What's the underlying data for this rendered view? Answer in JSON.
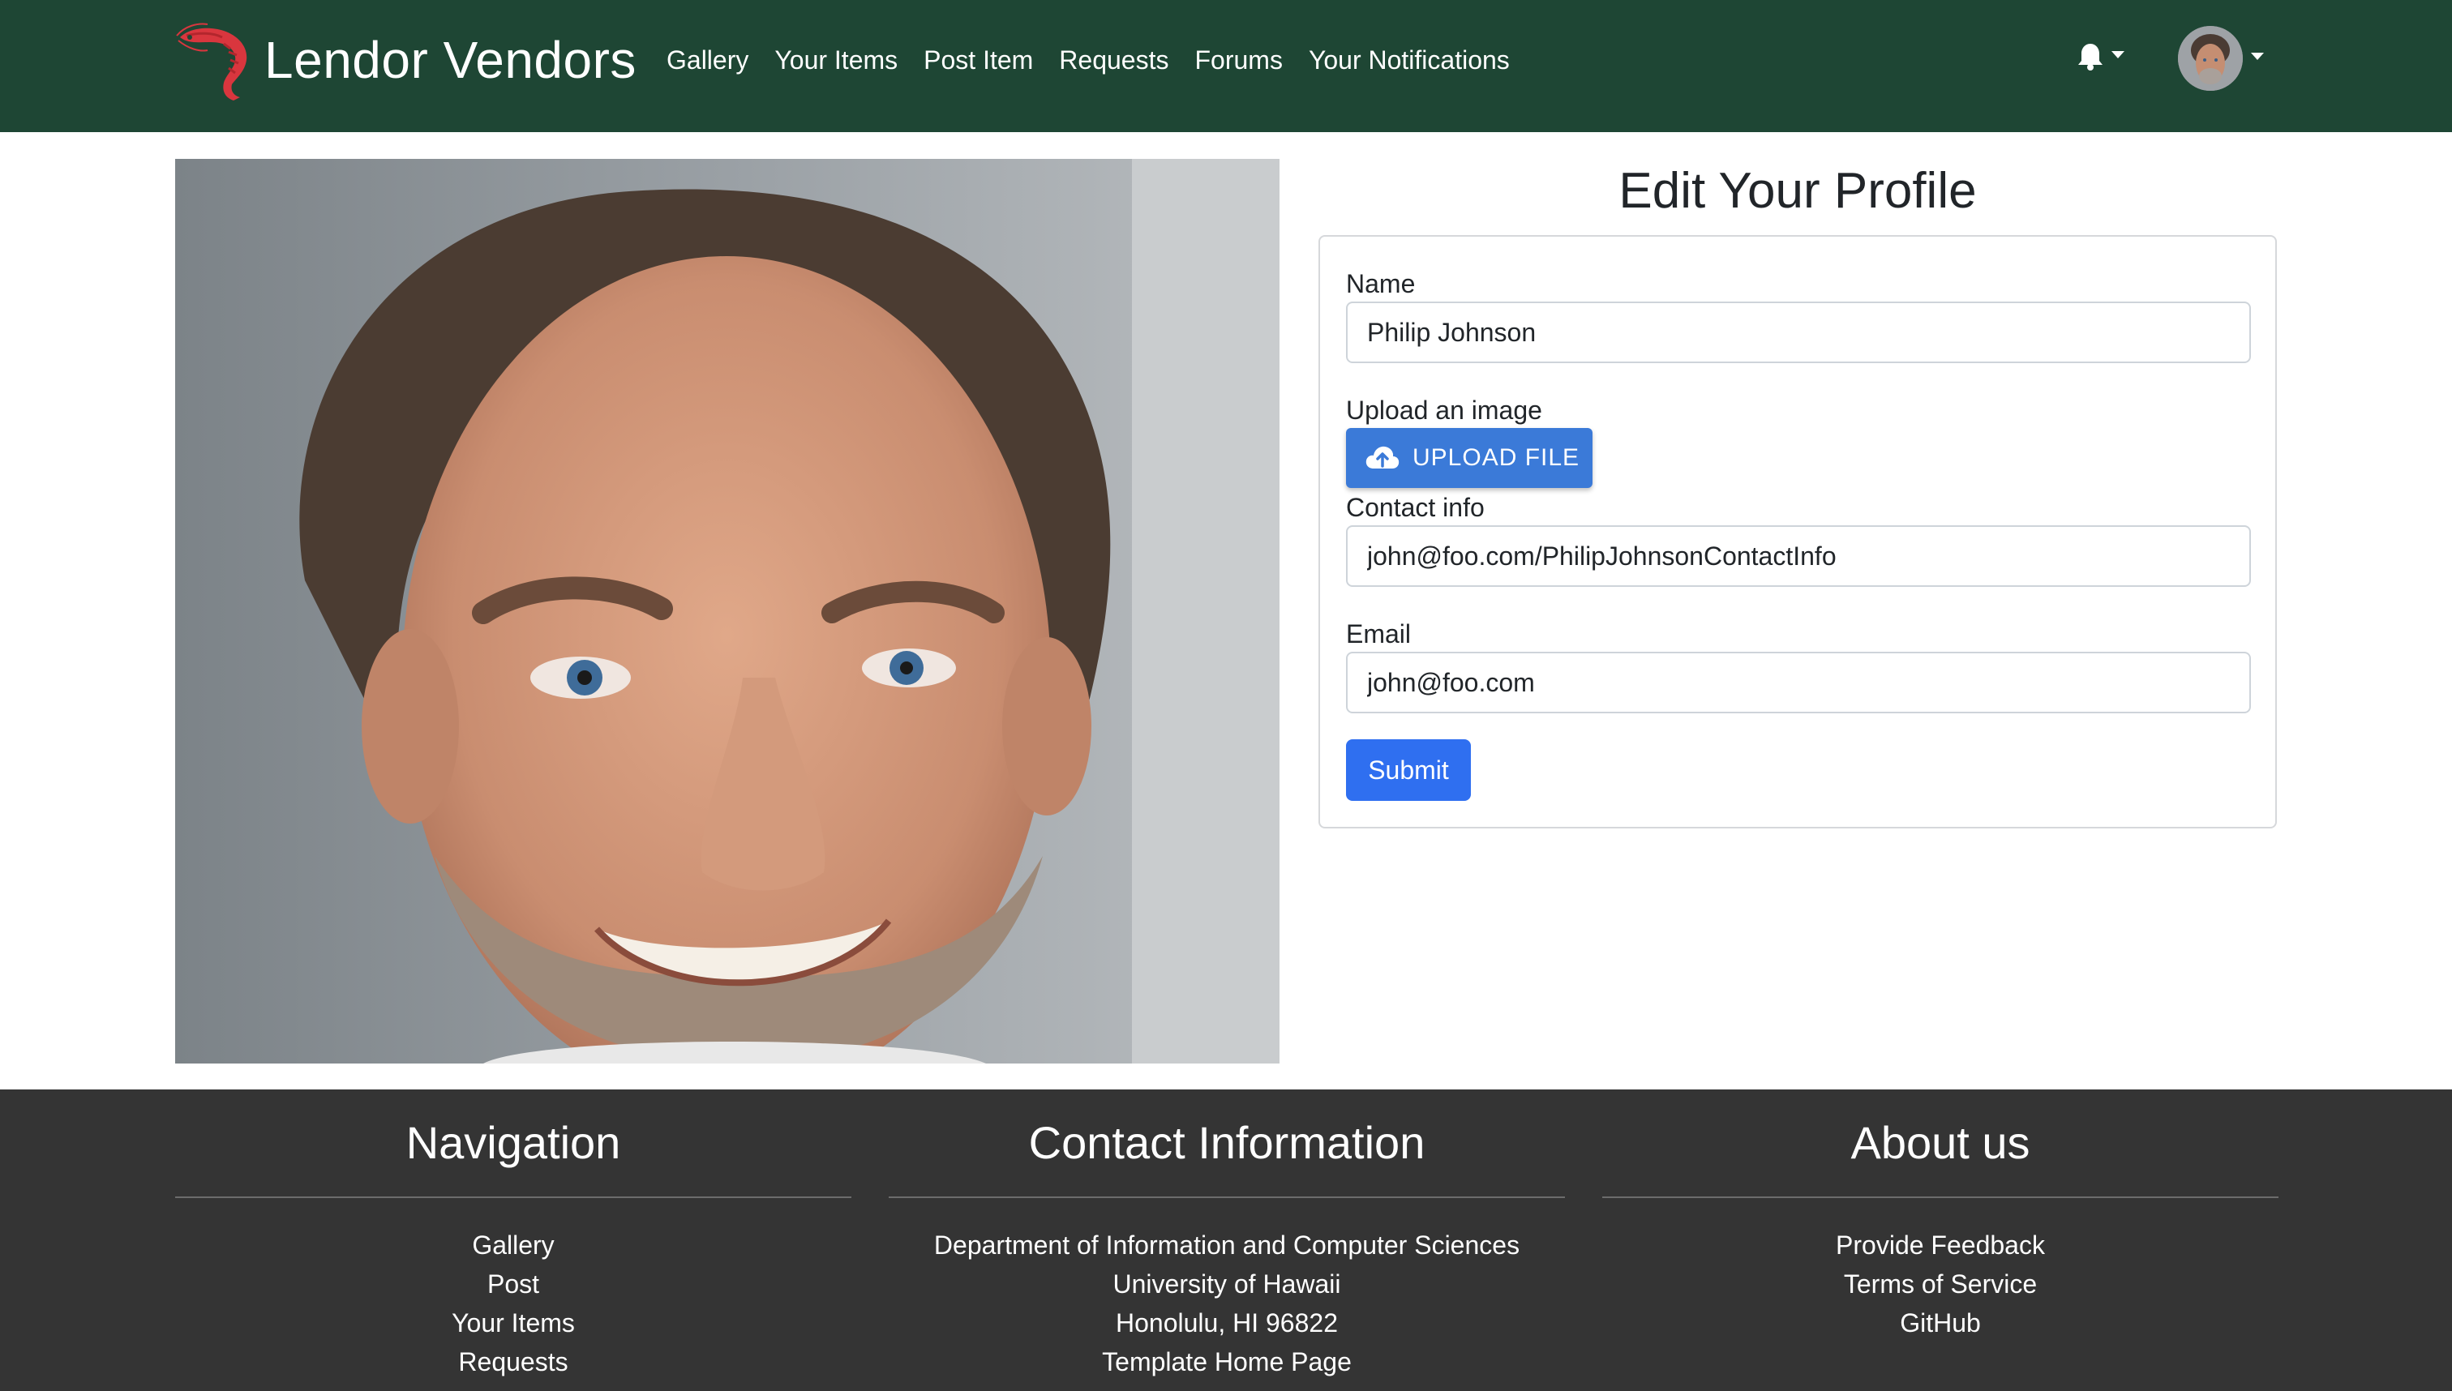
{
  "navbar": {
    "brand": "Lendor Vendors",
    "links": [
      "Gallery",
      "Your Items",
      "Post Item",
      "Requests",
      "Forums",
      "Your Notifications"
    ]
  },
  "profile": {
    "title": "Edit Your Profile",
    "name_label": "Name",
    "name_value": "Philip Johnson",
    "upload_label": "Upload an image",
    "upload_button": "UPLOAD FILE",
    "contact_label": "Contact info",
    "contact_value": "john@foo.com/PhilipJohnsonContactInfo",
    "email_label": "Email",
    "email_value": "john@foo.com",
    "submit_label": "Submit"
  },
  "footer": {
    "navigation": {
      "heading": "Navigation",
      "items": [
        "Gallery",
        "Post",
        "Your Items",
        "Requests"
      ]
    },
    "contact": {
      "heading": "Contact Information",
      "items": [
        "Department of Information and Computer Sciences",
        "University of Hawaii",
        "Honolulu, HI 96822",
        "Template Home Page"
      ]
    },
    "about": {
      "heading": "About us",
      "items": [
        "Provide Feedback",
        "Terms of Service",
        "GitHub"
      ]
    }
  },
  "colors": {
    "navbar_bg": "#1e4634",
    "footer_bg": "#343434",
    "upload_button": "#3b7ad8",
    "submit_button": "#2f6ff0",
    "logo": "#d9363e"
  },
  "icons": {
    "logo": "shrimp-logo-icon",
    "notifications": "bell-icon",
    "upload": "cloud-upload-icon"
  }
}
